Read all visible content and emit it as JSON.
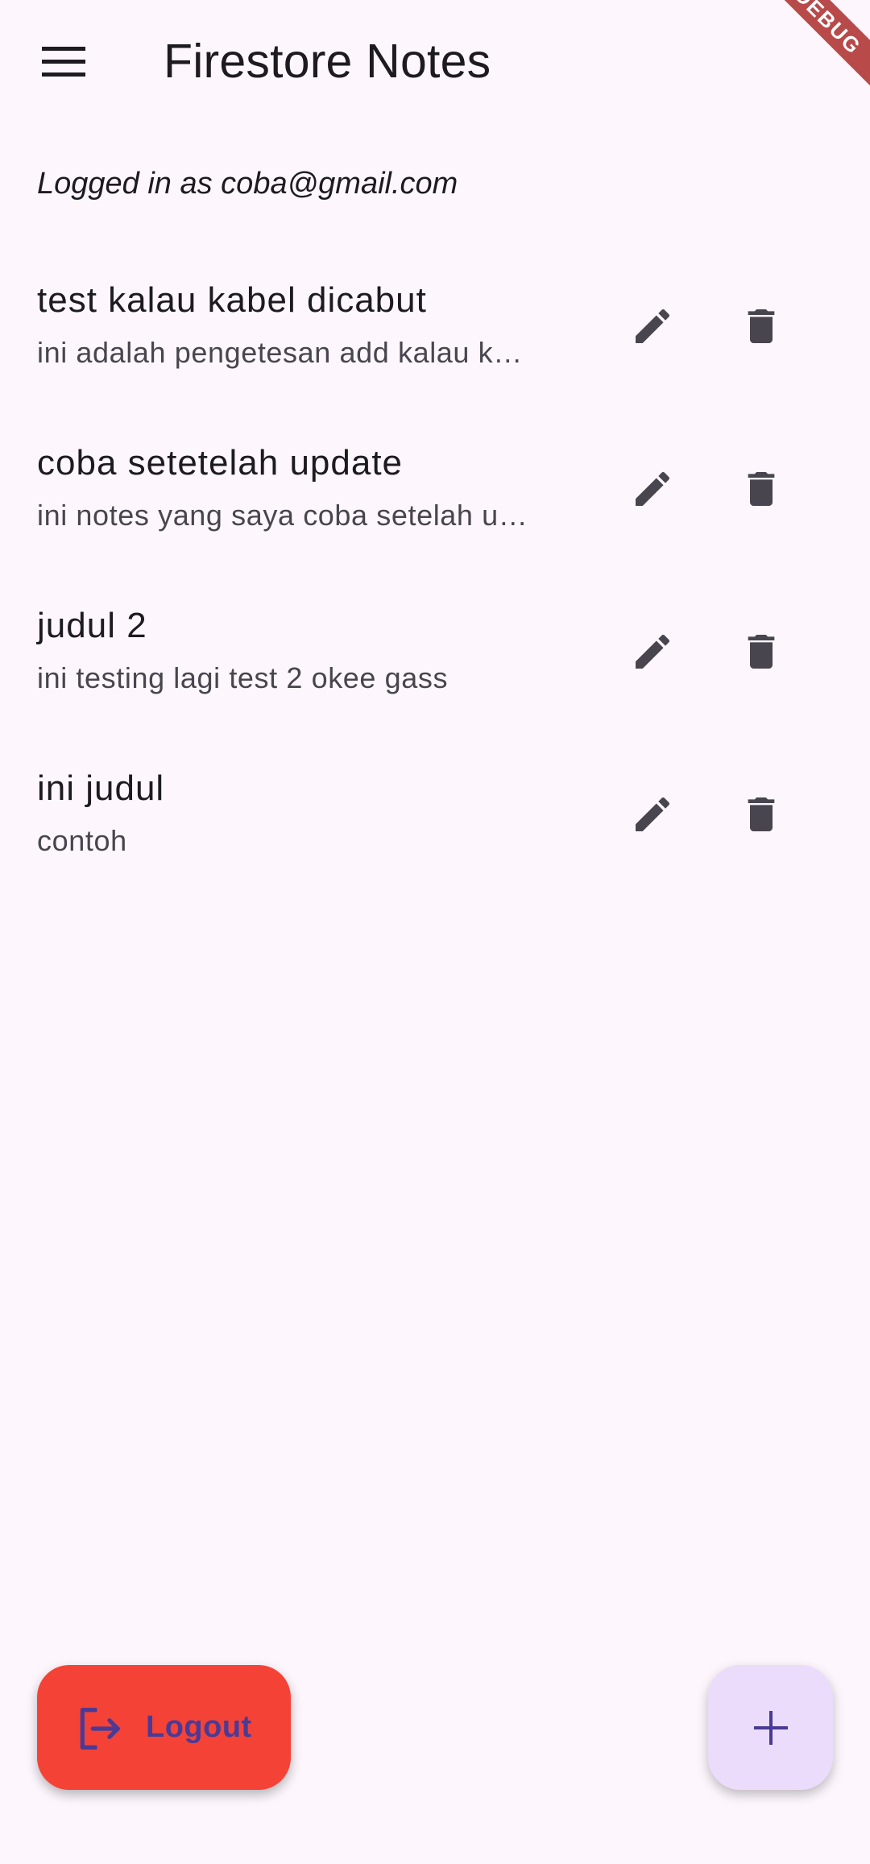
{
  "app_bar": {
    "title": "Firestore Notes",
    "menu_icon": "hamburger-menu-icon"
  },
  "debug_banner": {
    "label": "DEBUG",
    "color": "#b84a4a"
  },
  "session": {
    "logged_in_text": "Logged in as coba@gmail.com"
  },
  "notes": [
    {
      "title": "test kalau kabel dicabut",
      "content": "ini adalah pengetesan add kalau k…"
    },
    {
      "title": "coba setetelah update",
      "content": "ini notes yang saya coba setelah u…"
    },
    {
      "title": "judul 2",
      "content": "ini testing lagi test 2 okee gass"
    },
    {
      "title": "ini judul",
      "content": "contoh"
    }
  ],
  "note_actions": {
    "edit_icon": "pencil-icon",
    "delete_icon": "trash-icon",
    "icon_color": "#49454f"
  },
  "logout_fab": {
    "label": "Logout",
    "icon": "logout-icon",
    "background": "#f44336",
    "text_color": "#4a3a96"
  },
  "add_fab": {
    "icon": "plus-icon",
    "background": "#ebdcfb",
    "icon_color": "#4a3a96"
  },
  "theme": {
    "background": "#fdf7fd",
    "text_primary": "#1d1b20"
  }
}
